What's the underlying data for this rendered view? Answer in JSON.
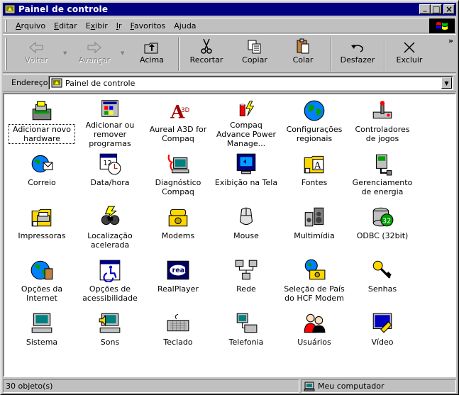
{
  "window": {
    "title": "Painel de controle"
  },
  "titlebar_buttons": {
    "minimize": "_",
    "maximize": "□",
    "close": "×"
  },
  "menu": [
    {
      "label": "Arquivo",
      "hotkey": "A",
      "rest": "rquivo"
    },
    {
      "label": "Editar",
      "hotkey": "E",
      "rest": "ditar"
    },
    {
      "label": "Exibir",
      "hotkey": "x",
      "pre": "E",
      "rest": "ibir"
    },
    {
      "label": "Ir",
      "hotkey": "I",
      "rest": "r"
    },
    {
      "label": "Favoritos",
      "hotkey": "F",
      "rest": "avoritos"
    },
    {
      "label": "Ajuda",
      "hotkey": "j",
      "pre": "A",
      "rest": "uda"
    }
  ],
  "toolbar": {
    "back": "Voltar",
    "forward": "Avançar",
    "up": "Acima",
    "cut": "Recortar",
    "copy": "Copiar",
    "paste": "Colar",
    "undo": "Desfazer",
    "delete": "Excluir",
    "more": "»"
  },
  "address": {
    "label": "Endereço",
    "value": "Painel de controle"
  },
  "icons": [
    {
      "label": "Adicionar novo hardware",
      "icon": "add-hardware-icon",
      "selected": true
    },
    {
      "label": "Adicionar ou remover programas",
      "icon": "add-remove-programs-icon"
    },
    {
      "label": "Aureal A3D for Compaq",
      "icon": "aureal-a3d-icon"
    },
    {
      "label": "Compaq Advance Power Manage...",
      "icon": "compaq-power-icon"
    },
    {
      "label": "Configurações regionais",
      "icon": "regional-settings-icon"
    },
    {
      "label": "Controladores de jogos",
      "icon": "game-controllers-icon"
    },
    {
      "label": "Correio",
      "icon": "mail-icon"
    },
    {
      "label": "Data/hora",
      "icon": "date-time-icon"
    },
    {
      "label": "Diagnóstico Compaq",
      "icon": "compaq-diagnostics-icon"
    },
    {
      "label": "Exibição na Tela",
      "icon": "display-icon"
    },
    {
      "label": "Fontes",
      "icon": "fonts-icon"
    },
    {
      "label": "Gerenciamento de energia",
      "icon": "power-management-icon"
    },
    {
      "label": "Impressoras",
      "icon": "printers-icon"
    },
    {
      "label": "Localização acelerada",
      "icon": "find-fast-icon"
    },
    {
      "label": "Modems",
      "icon": "modems-icon"
    },
    {
      "label": "Mouse",
      "icon": "mouse-icon"
    },
    {
      "label": "Multimídia",
      "icon": "multimedia-icon"
    },
    {
      "label": "ODBC (32bit)",
      "icon": "odbc-icon"
    },
    {
      "label": "Opções da Internet",
      "icon": "internet-options-icon"
    },
    {
      "label": "Opções de acessibilidade",
      "icon": "accessibility-icon"
    },
    {
      "label": "RealPlayer",
      "icon": "realplayer-icon"
    },
    {
      "label": "Rede",
      "icon": "network-icon"
    },
    {
      "label": "Seleção de País do HCF Modem",
      "icon": "hcf-modem-country-icon"
    },
    {
      "label": "Senhas",
      "icon": "passwords-icon"
    },
    {
      "label": "Sistema",
      "icon": "system-icon"
    },
    {
      "label": "Sons",
      "icon": "sounds-icon"
    },
    {
      "label": "Teclado",
      "icon": "keyboard-icon"
    },
    {
      "label": "Telefonia",
      "icon": "telephony-icon"
    },
    {
      "label": "Usuários",
      "icon": "users-icon"
    },
    {
      "label": "Vídeo",
      "icon": "video-icon"
    }
  ],
  "status": {
    "count": "30 objeto(s)",
    "location": "Meu computador"
  },
  "colors": {
    "titlebar": "#000080",
    "face": "#c0c0c0",
    "content_bg": "#ffffff"
  }
}
